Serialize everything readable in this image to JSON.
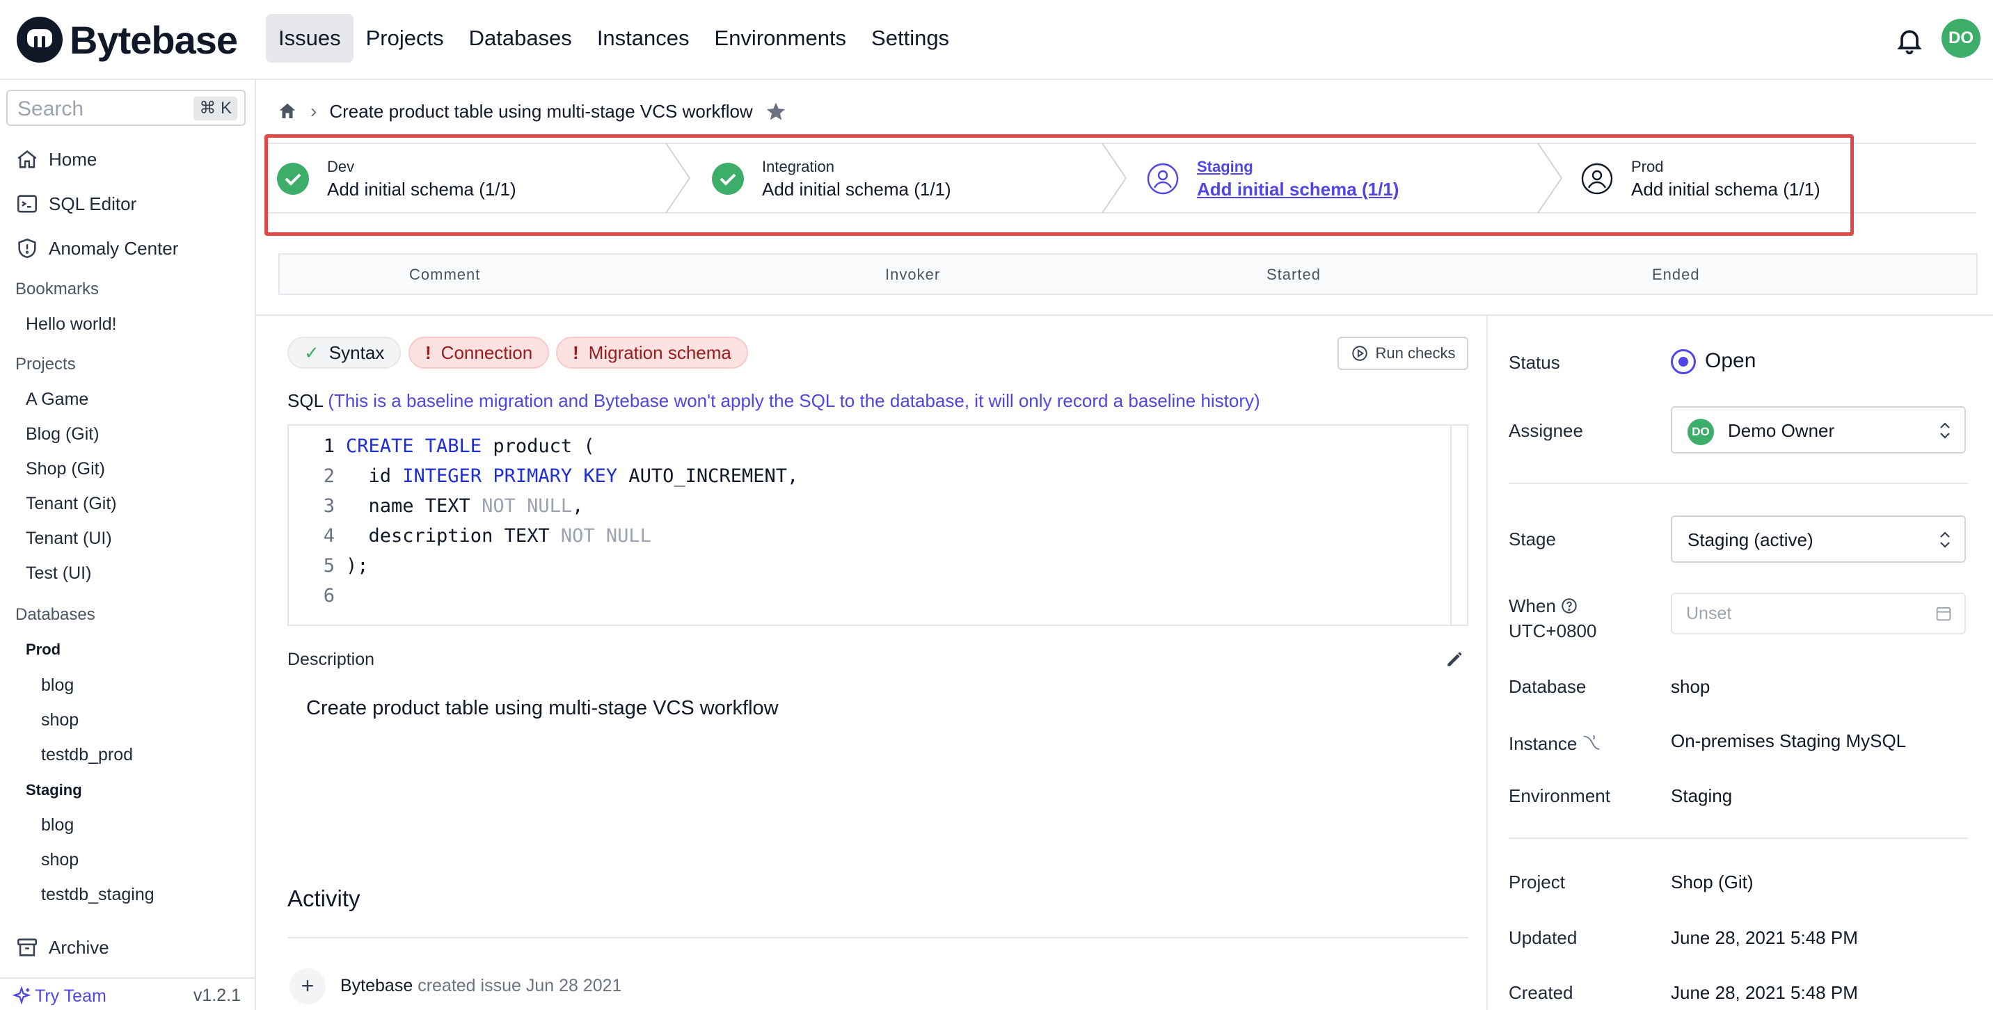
{
  "app": {
    "brand": "Bytebase",
    "nav": [
      "Issues",
      "Projects",
      "Databases",
      "Instances",
      "Environments",
      "Settings"
    ],
    "active_nav": "Issues",
    "user_initials": "DO"
  },
  "sidebar": {
    "search_placeholder": "Search",
    "search_shortcut": "⌘ K",
    "links": [
      "Home",
      "SQL Editor",
      "Anomaly Center"
    ],
    "bookmarks_title": "Bookmarks",
    "bookmarks": [
      "Hello world!"
    ],
    "projects_title": "Projects",
    "projects": [
      "A Game",
      "Blog (Git)",
      "Shop (Git)",
      "Tenant (Git)",
      "Tenant (UI)",
      "Test (UI)"
    ],
    "databases_title": "Databases",
    "env_prod": "Prod",
    "prod_dbs": [
      "blog",
      "shop",
      "testdb_prod"
    ],
    "env_staging": "Staging",
    "staging_dbs": [
      "blog",
      "shop",
      "testdb_staging"
    ],
    "archive": "Archive",
    "try_team": "Try Team",
    "version": "v1.2.1"
  },
  "issue": {
    "title": "Create product table using multi-stage VCS workflow",
    "stages": [
      {
        "env": "Dev",
        "task": "Add initial schema (1/1)",
        "state": "done"
      },
      {
        "env": "Integration",
        "task": "Add initial schema (1/1)",
        "state": "done"
      },
      {
        "env": "Staging",
        "task": "Add initial schema (1/1)",
        "state": "active"
      },
      {
        "env": "Prod",
        "task": "Add initial schema (1/1)",
        "state": "pending"
      }
    ],
    "task_run_columns": [
      "Comment",
      "Invoker",
      "Started",
      "Ended"
    ],
    "checks": {
      "syntax": "Syntax",
      "connection": "Connection",
      "migration": "Migration schema",
      "run_label": "Run checks"
    },
    "sql_label": "SQL",
    "sql_note": "(This is a baseline migration and Bytebase won't apply the SQL to the database, it will only record a baseline history)",
    "line_numbers": [
      "1",
      "2",
      "3",
      "4",
      "5",
      "6"
    ],
    "description_label": "Description",
    "description": "Create product table using multi-stage VCS workflow",
    "activity_title": "Activity",
    "activity": {
      "actor": "Bytebase",
      "text": "created issue Jun 28 2021"
    }
  },
  "panel": {
    "status_label": "Status",
    "status": "Open",
    "assignee_label": "Assignee",
    "assignee": "Demo Owner",
    "assignee_initials": "DO",
    "stage_label": "Stage",
    "stage": "Staging (active)",
    "when_label": "When",
    "timezone": "UTC+0800",
    "when_placeholder": "Unset",
    "database_label": "Database",
    "database": "shop",
    "instance_label": "Instance",
    "instance": "On-premises Staging MySQL",
    "environment_label": "Environment",
    "environment": "Staging",
    "project_label": "Project",
    "project": "Shop (Git)",
    "updated_label": "Updated",
    "updated": "June 28, 2021 5:48 PM",
    "created_label": "Created",
    "created": "June 28, 2021 5:48 PM"
  },
  "colors": {
    "accent": "#4f46e5",
    "success": "#3dae6a",
    "error_bg": "#fde2e2",
    "highlight": "#e04848"
  }
}
